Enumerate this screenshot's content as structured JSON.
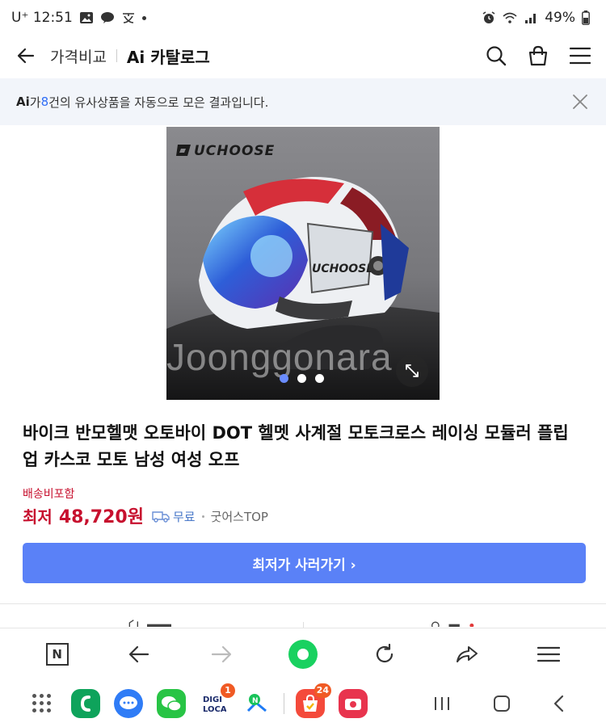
{
  "status_bar": {
    "carrier": "U⁺ 12:51",
    "battery": "49%"
  },
  "header": {
    "breadcrumb": "가격비교",
    "title": "Ai 카탈로그"
  },
  "notice": {
    "ai_label": "Ai",
    "text_before": "가 ",
    "count": "8",
    "text_after": "건의 유사상품을 자동으로 모은 결과입니다."
  },
  "product": {
    "image": {
      "brand_logo": "UCHOOSE",
      "watermark": "Joonggonara",
      "slide_count": 3,
      "active_slide": 1
    },
    "title": "바이크 반모헬맷 오토바이 DOT 헬멧 사계절 모토크로스 레이싱 모듈러 플립 업 카스코 모토 남성 여성 오프",
    "shipping_label": "배송비포함",
    "price_prefix": "최저",
    "price": "48,720원",
    "shipping_free": "무료",
    "seller": "굿어스TOP",
    "cta_label": "최저가 사러가기 ›"
  },
  "colors": {
    "accent_blue": "#5a81f7",
    "price_red": "#c7102e",
    "notice_bg": "#f2f5fa",
    "browser_green": "#19d160"
  },
  "dock": {
    "apps": [
      {
        "name": "phone",
        "color": "#0ea35b"
      },
      {
        "name": "messages",
        "color": "#2f7cf6"
      },
      {
        "name": "wechat",
        "color": "#28c445"
      },
      {
        "name": "digiloca",
        "label": "DIGI LOCA",
        "badge": "1"
      },
      {
        "name": "naver-map"
      },
      {
        "name": "shopping",
        "color": "#f44a3b",
        "badge": "24"
      },
      {
        "name": "camera",
        "color": "#e8344e"
      }
    ]
  }
}
